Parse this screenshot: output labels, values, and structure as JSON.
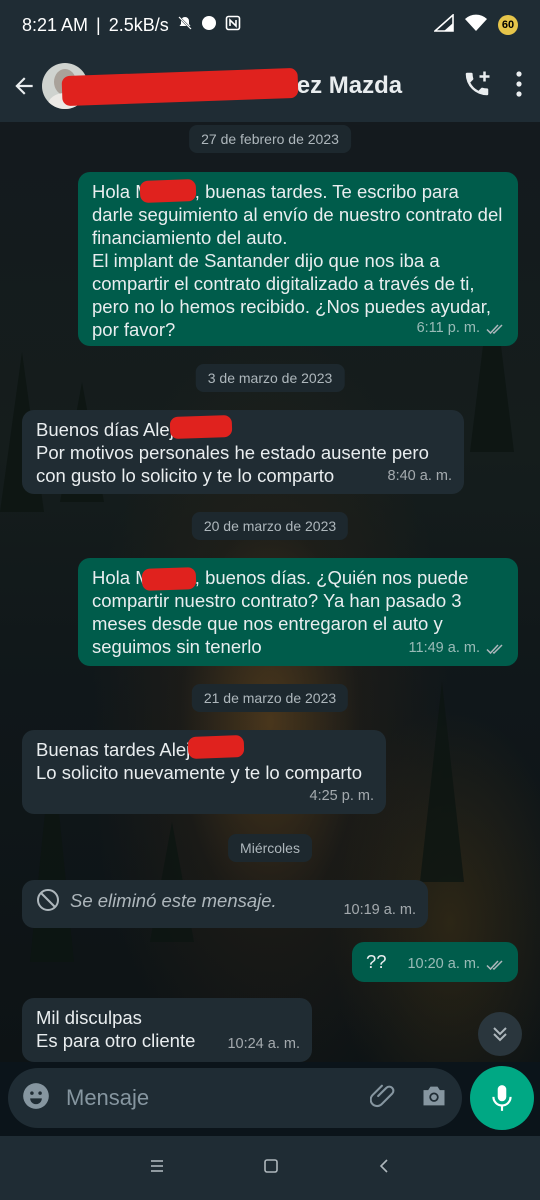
{
  "status_bar": {
    "time": "8:21 AM",
    "separator": "|",
    "net_speed": "2.5kB/s",
    "battery_level": "60"
  },
  "header": {
    "contact_name": "Mariana Hernández Mazda",
    "icons": [
      "back-arrow-icon",
      "add-call-icon",
      "more-vert-icon"
    ]
  },
  "chat": {
    "date_chips": [
      "27 de febrero de 2023",
      "3 de marzo de 2023",
      "20 de marzo de 2023",
      "21 de marzo de 2023",
      "Miércoles"
    ],
    "messages": [
      {
        "direction": "out",
        "text": "Hola Marisol, buenas tardes. Te escribo para darle seguimiento al envío de nuestro contrato del financiamiento del auto.\nEl implant de Santander dijo que nos iba a compartir el contrato digitalizado a través de ti, pero no lo hemos recibido. ¿Nos puedes ayudar, por favor?",
        "time": "6:11 p. m.",
        "status": "read"
      },
      {
        "direction": "in",
        "text": "Buenos días Alejandro\nPor motivos personales he estado ausente pero con gusto lo solicito y te lo comparto",
        "time": "8:40 a. m."
      },
      {
        "direction": "out",
        "text": "Hola Marisol, buenos días. ¿Quién nos puede compartir nuestro contrato? Ya han pasado 3 meses desde que nos entregaron el auto y seguimos sin tenerlo",
        "time": "11:49 a. m.",
        "status": "read"
      },
      {
        "direction": "in",
        "text": "Buenas tardes Alejandro\nLo solicito nuevamente y te lo comparto",
        "time": "4:25 p. m."
      },
      {
        "direction": "in",
        "deleted": true,
        "text": "Se eliminó este mensaje.",
        "time": "10:19 a. m."
      },
      {
        "direction": "out",
        "text": "??",
        "time": "10:20 a. m.",
        "status": "read"
      },
      {
        "direction": "in",
        "text": "Mil disculpas\nEs para otro cliente",
        "time": "10:24 a. m."
      }
    ]
  },
  "composer": {
    "placeholder": "Mensaje",
    "icons": [
      "emoji-icon",
      "attach-icon",
      "camera-icon",
      "mic-icon"
    ]
  },
  "colors": {
    "outgoing_bubble": "#005c4b",
    "incoming_bubble": "#202c33",
    "accent": "#00a884",
    "header_bg": "#1f2c34",
    "redaction": "#e0221e"
  }
}
